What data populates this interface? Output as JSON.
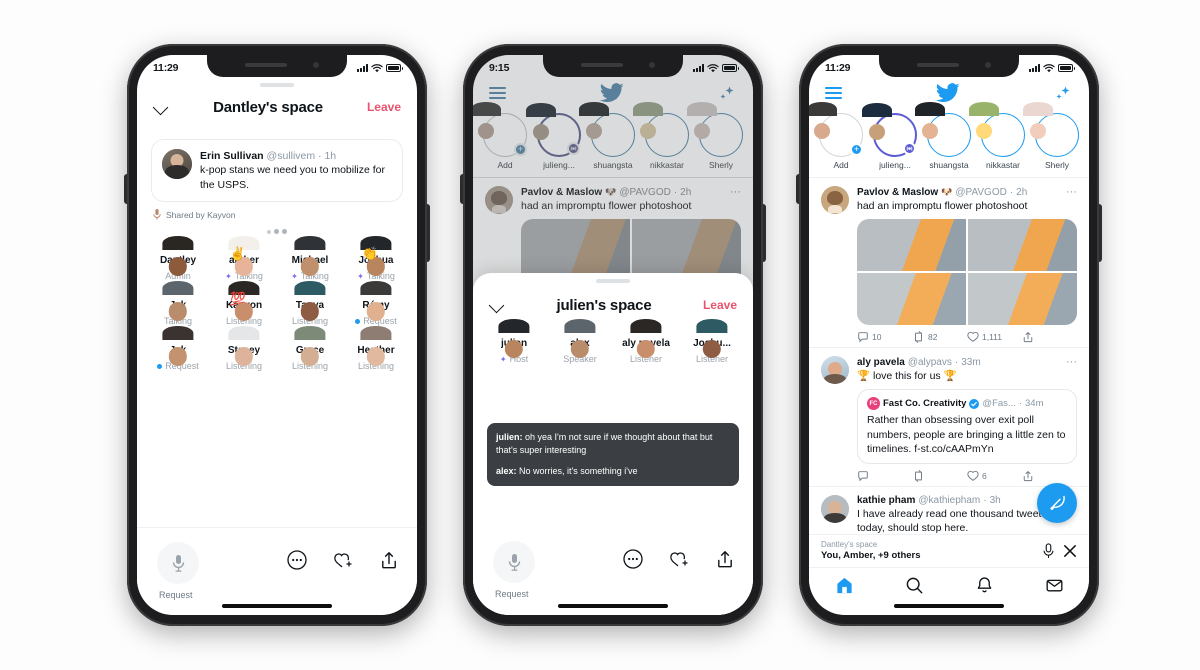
{
  "phone1": {
    "status": {
      "time": "11:29"
    },
    "space": {
      "title": "Dantley's space",
      "leave_label": "Leave",
      "shared_tweet": {
        "name": "Erin Sullivan",
        "handle": "@sullivem",
        "time": "1h",
        "text": "k-pop stans we need you to mobilize for the USPS."
      },
      "shared_by": "Shared by Kayvon",
      "participants": [
        {
          "name": "Dantley",
          "role": "Admin",
          "indicator": "none"
        },
        {
          "name": "amber",
          "role": "Talking",
          "indicator": "mic",
          "emoji": "✌️"
        },
        {
          "name": "Michael",
          "role": "Talking",
          "indicator": "mic"
        },
        {
          "name": "Joshua",
          "role": "Talking",
          "indicator": "mic",
          "emoji": "👏"
        },
        {
          "name": "Jak",
          "role": "Talking",
          "indicator": "none"
        },
        {
          "name": "Kayvon",
          "role": "Listening",
          "indicator": "none",
          "emoji": "💯"
        },
        {
          "name": "Tanya",
          "role": "Listening",
          "indicator": "none"
        },
        {
          "name": "Rémy",
          "role": "Request",
          "indicator": "dot"
        },
        {
          "name": "Jak",
          "role": "Request",
          "indicator": "dot"
        },
        {
          "name": "Stacey",
          "role": "Listening",
          "indicator": "none"
        },
        {
          "name": "Grace",
          "role": "Listening",
          "indicator": "none"
        },
        {
          "name": "Heather",
          "role": "Listening",
          "indicator": "none"
        }
      ],
      "controls": {
        "mic_label": "Request",
        "more_label": "More",
        "react_label": "React",
        "share_label": "Share"
      }
    }
  },
  "phone2": {
    "status": {
      "time": "9:15"
    },
    "timeline": {
      "fleets": [
        {
          "label": "Add",
          "kind": "add"
        },
        {
          "label": "julieng...",
          "kind": "space"
        },
        {
          "label": "shuangsta",
          "kind": "fleet"
        },
        {
          "label": "nikkastar",
          "kind": "fleet"
        },
        {
          "label": "Sherly",
          "kind": "fleet"
        }
      ],
      "tweet": {
        "name": "Pavlov & Maslow",
        "emoji": "🐶",
        "handle": "@PAVGOD",
        "time": "2h",
        "text": "had an impromptu flower photoshoot"
      }
    },
    "space": {
      "title": "julien's space",
      "leave_label": "Leave",
      "participants": [
        {
          "name": "julien",
          "role": "Host",
          "indicator": "mic"
        },
        {
          "name": "alex",
          "role": "Speaker",
          "indicator": "none"
        },
        {
          "name": "aly pavela",
          "role": "Listener",
          "indicator": "none"
        },
        {
          "name": "Joshu...",
          "role": "Listener",
          "indicator": "none"
        }
      ],
      "captions": [
        {
          "who": "julien:",
          "text": "oh yea I'm not sure if we thought about that but that's super interesting"
        },
        {
          "who": "alex:",
          "text": "No worries, it's something i've"
        }
      ],
      "controls": {
        "mic_label": "Request",
        "more_label": "More",
        "react_label": "React",
        "share_label": "Share"
      }
    }
  },
  "phone3": {
    "status": {
      "time": "11:29"
    },
    "timeline": {
      "fleets": [
        {
          "label": "Add",
          "kind": "add"
        },
        {
          "label": "julieng...",
          "kind": "space"
        },
        {
          "label": "shuangsta",
          "kind": "fleet"
        },
        {
          "label": "nikkastar",
          "kind": "fleet"
        },
        {
          "label": "Sherly",
          "kind": "fleet"
        }
      ],
      "tweets": [
        {
          "name": "Pavlov & Maslow",
          "emoji": "🐶",
          "handle": "@PAVGOD",
          "time": "2h",
          "text": "had an impromptu flower photoshoot",
          "has_photos": true,
          "stats": {
            "replies": "10",
            "retweets": "82",
            "likes": "1,111"
          }
        },
        {
          "name": "aly pavela",
          "handle": "@alypavs",
          "time": "33m",
          "text": "🏆 love this for us 🏆",
          "quoted": {
            "name": "Fast Co. Creativity",
            "handle": "@Fas...",
            "time": "34m",
            "verified": true,
            "text": "Rather than obsessing over exit poll numbers, people are bringing a little zen to timelines. f-st.co/cAAPmYn"
          },
          "stats": {
            "replies": "",
            "retweets": "",
            "likes": "6"
          }
        },
        {
          "name": "kathie pham",
          "handle": "@kathiepham",
          "time": "3h",
          "text": "I have already read one thousand tweets today, should stop here."
        }
      ]
    },
    "miniplayer": {
      "title": "Dantley's space",
      "subtitle": "You, Amber, +9 others",
      "mic_label": "Mic",
      "close_label": "Close"
    },
    "tabs": [
      {
        "label": "Home",
        "icon": "home-icon",
        "active": true
      },
      {
        "label": "Search",
        "icon": "search-icon",
        "active": false
      },
      {
        "label": "Notifications",
        "icon": "bell-icon",
        "active": false
      },
      {
        "label": "Messages",
        "icon": "envelope-icon",
        "active": false
      }
    ],
    "compose_label": "Compose"
  },
  "colors": {
    "twitter_blue": "#1d9bf0",
    "leave_pink": "#e8536e",
    "space_purple": "#5b5bd6",
    "text": "#0f1419",
    "muted": "#8b98a5"
  }
}
